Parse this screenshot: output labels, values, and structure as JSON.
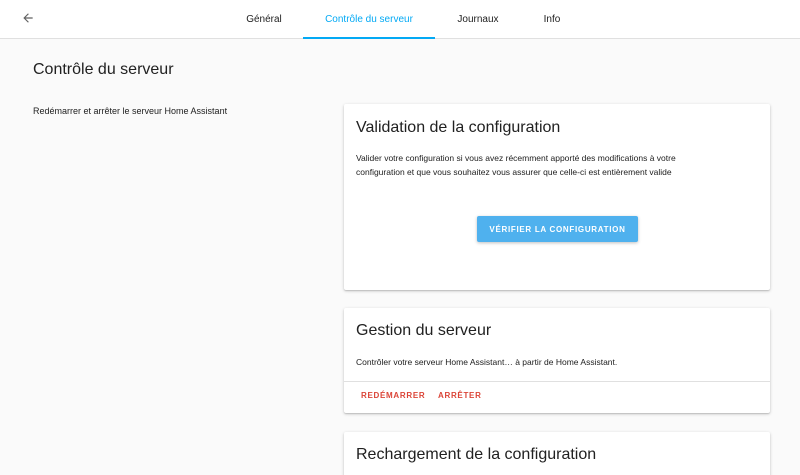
{
  "header": {
    "back_icon": "arrow-left-icon",
    "tabs": [
      {
        "label": "Général",
        "active": false
      },
      {
        "label": "Contrôle du serveur",
        "active": true
      },
      {
        "label": "Journaux",
        "active": false
      },
      {
        "label": "Info",
        "active": false
      }
    ]
  },
  "colors": {
    "accent": "#03a9f4",
    "button": "#4fb1ee",
    "danger": "#db4437"
  },
  "page": {
    "title": "Contrôle du serveur",
    "intro": "Redémarrer et arrêter le serveur Home Assistant"
  },
  "validation_card": {
    "title": "Validation de la configuration",
    "text_line1": "Valider votre configuration si vous avez récemment apporté des modifications à votre",
    "text_line2": "configuration et que vous souhaitez vous assurer que celle-ci est entièrement valide",
    "button_label": "VÉRIFIER LA CONFIGURATION"
  },
  "server_card": {
    "title": "Gestion du serveur",
    "text": "Contrôler votre serveur Home Assistant… à partir de Home Assistant.",
    "restart_label": "REDÉMARRER",
    "stop_label": "ARRÊTER"
  },
  "reload_card": {
    "title": "Rechargement de la configuration"
  }
}
